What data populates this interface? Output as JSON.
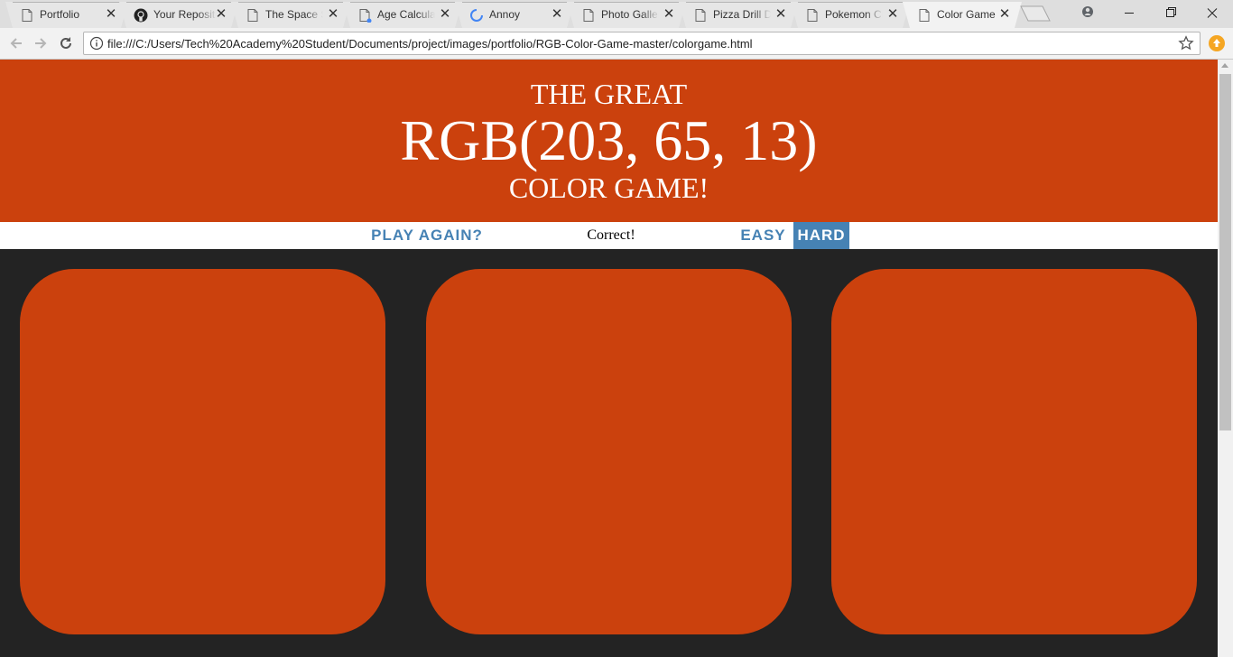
{
  "browser": {
    "tabs": [
      {
        "title": "Portfolio",
        "icon": "page-icon",
        "active": false
      },
      {
        "title": "Your Reposit",
        "icon": "github-icon",
        "active": false
      },
      {
        "title": "The Space S",
        "icon": "page-icon",
        "active": false
      },
      {
        "title": "Age Calculat",
        "icon": "page-icon",
        "active": false
      },
      {
        "title": "Annoy",
        "icon": "loading-spinner-icon",
        "active": false
      },
      {
        "title": "Photo Galler",
        "icon": "page-icon",
        "active": false
      },
      {
        "title": "Pizza Drill Di",
        "icon": "page-icon",
        "active": false
      },
      {
        "title": "Pokemon Ch",
        "icon": "page-icon",
        "active": false
      },
      {
        "title": "Color Game",
        "icon": "page-icon",
        "active": true
      }
    ],
    "close_glyph": "✕",
    "address": "file:///C:/Users/Tech%20Academy%20Student/Documents/project/images/portfolio/RGB-Color-Game-master/colorgame.html"
  },
  "game": {
    "title_top": "THE GREAT",
    "color_display": "RGB(203, 65, 13)",
    "title_bottom": "COLOR GAME!",
    "header_color": "#cb410d",
    "reset_label": "Play Again?",
    "message": "Correct!",
    "modes": [
      {
        "label": "Easy",
        "selected": false
      },
      {
        "label": "Hard",
        "selected": true
      }
    ],
    "accent_color": "#4682b4",
    "square_colors": [
      "#cb410d",
      "#cb410d",
      "#cb410d"
    ],
    "background_color": "#232323"
  }
}
